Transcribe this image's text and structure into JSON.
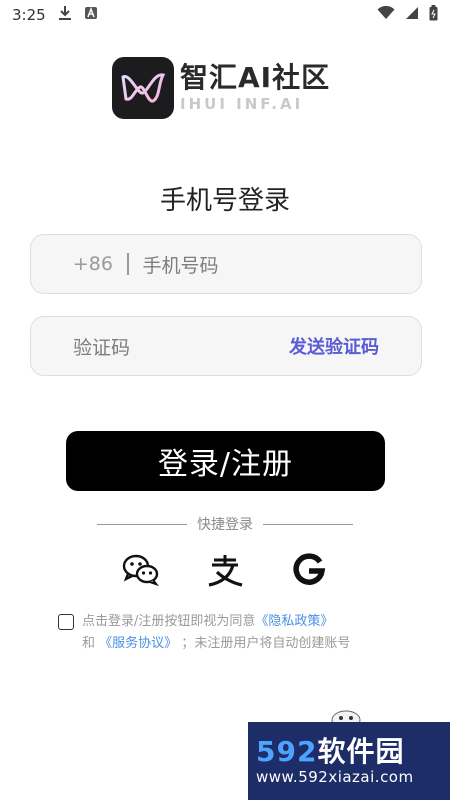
{
  "status_bar": {
    "time": "3:25"
  },
  "logo": {
    "title": "智汇AI社区",
    "subtitle": "IHUI INF.AI"
  },
  "page": {
    "title": "手机号登录"
  },
  "phone": {
    "prefix": "+86",
    "placeholder": "手机号码"
  },
  "code": {
    "placeholder": "验证码",
    "send_label": "发送验证码"
  },
  "login_button": {
    "label": "登录/注册"
  },
  "quick_login": {
    "label": "快捷登录",
    "providers": [
      "wechat-icon",
      "alipay-icon",
      "google-icon"
    ]
  },
  "agreement": {
    "line1_text": "点击登录/注册按钮即视为同意",
    "privacy_link": "《隐私政策》",
    "line2_prefix": "和",
    "terms_link": "《服务协议》",
    "line2_suffix": "；未注册用户将自动创建账号"
  },
  "watermark": {
    "brand_num": "592",
    "brand_text": "软件园",
    "url": "www.592xiazai.com"
  },
  "colors": {
    "accent": "#5b5bd6",
    "link": "#4a90e2",
    "button": "#000000"
  }
}
